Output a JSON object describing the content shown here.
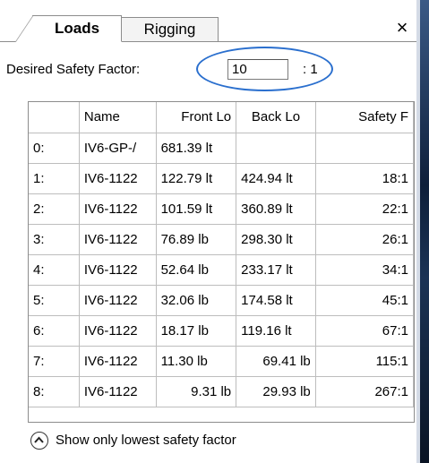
{
  "tabs": [
    {
      "label": "Loads",
      "active": true
    },
    {
      "label": "Rigging",
      "active": false
    }
  ],
  "close_label": "×",
  "safety": {
    "label": "Desired Safety Factor:",
    "value": "10",
    "suffix": ": 1",
    "highlight_color": "#2a6fce"
  },
  "grid": {
    "columns": [
      "",
      "Name",
      "Front Lo",
      "Back Lo",
      "Safety F"
    ],
    "rows": [
      {
        "index": "0:",
        "name": "IV6-GP-/",
        "front": "681.39 lt",
        "back": "",
        "safety": ""
      },
      {
        "index": "1:",
        "name": "IV6-1122",
        "front": "122.79 lt",
        "back": "424.94 lt",
        "safety": "18:1"
      },
      {
        "index": "2:",
        "name": "IV6-1122",
        "front": "101.59 lt",
        "back": "360.89 lt",
        "safety": "22:1"
      },
      {
        "index": "3:",
        "name": "IV6-1122",
        "front": "76.89 lb",
        "back": "298.30 lt",
        "safety": "26:1"
      },
      {
        "index": "4:",
        "name": "IV6-1122",
        "front": "52.64 lb",
        "back": "233.17 lt",
        "safety": "34:1"
      },
      {
        "index": "5:",
        "name": "IV6-1122",
        "front": "32.06 lb",
        "back": "174.58 lt",
        "safety": "45:1"
      },
      {
        "index": "6:",
        "name": "IV6-1122",
        "front": "18.17 lb",
        "back": "119.16 lt",
        "safety": "67:1"
      },
      {
        "index": "7:",
        "name": "IV6-1122",
        "front": "11.30 lb",
        "back": "69.41 lb",
        "safety": "115:1"
      },
      {
        "index": "8:",
        "name": "IV6-1122",
        "front": "9.31 lb",
        "back": "29.93 lb",
        "safety": "267:1"
      }
    ]
  },
  "toggle": {
    "icon": "chevron-up-circle-icon",
    "label": "Show only lowest safety factor"
  }
}
